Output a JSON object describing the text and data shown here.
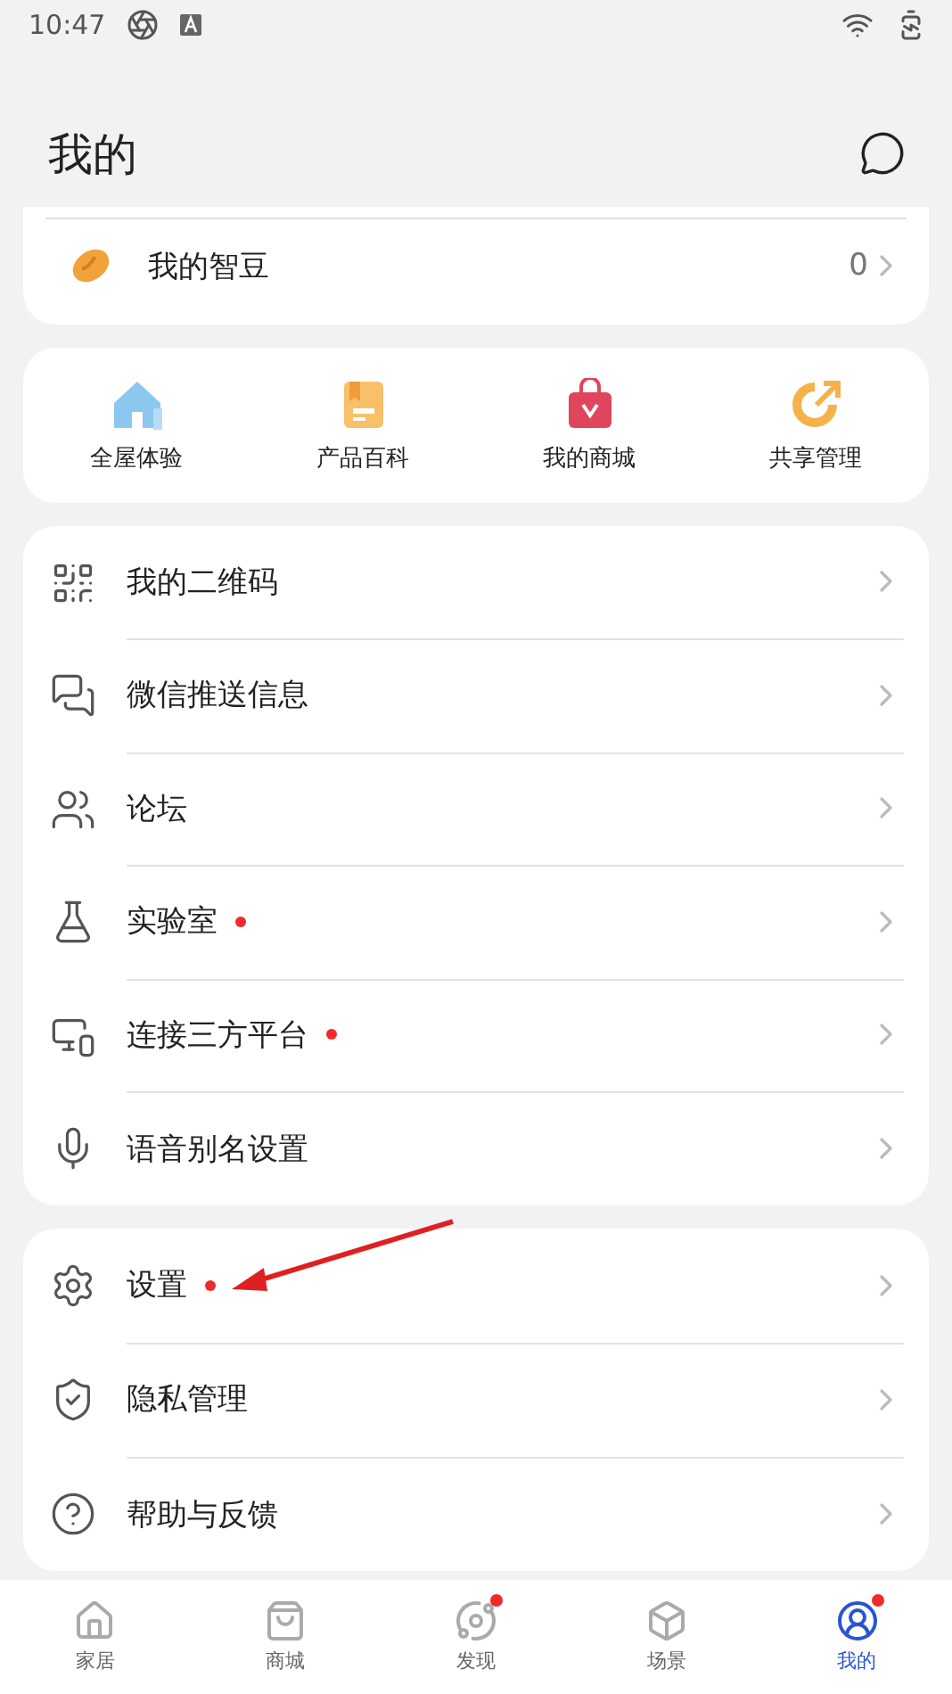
{
  "status_bar": {
    "time": "10:47"
  },
  "header": {
    "title": "我的"
  },
  "bean_row": {
    "label": "我的智豆",
    "value": "0"
  },
  "shortcuts": [
    {
      "label": "全屋体验",
      "kind": "house"
    },
    {
      "label": "产品百科",
      "kind": "book"
    },
    {
      "label": "我的商城",
      "kind": "bag"
    },
    {
      "label": "共享管理",
      "kind": "share"
    }
  ],
  "menu_groups": [
    [
      {
        "label": "我的二维码",
        "kind": "qr",
        "dot": false
      },
      {
        "label": "微信推送信息",
        "kind": "chat",
        "dot": false
      },
      {
        "label": "论坛",
        "kind": "users",
        "dot": false
      },
      {
        "label": "实验室",
        "kind": "flask",
        "dot": true
      },
      {
        "label": "连接三方平台",
        "kind": "link",
        "dot": true
      },
      {
        "label": "语音别名设置",
        "kind": "mic",
        "dot": false
      }
    ],
    [
      {
        "label": "设置",
        "kind": "gear",
        "dot": true
      },
      {
        "label": "隐私管理",
        "kind": "shield",
        "dot": false
      },
      {
        "label": "帮助与反馈",
        "kind": "help",
        "dot": false
      }
    ]
  ],
  "tab_bar": [
    {
      "label": "家居",
      "kind": "home",
      "selected": false,
      "dot": false
    },
    {
      "label": "商城",
      "kind": "store",
      "selected": false,
      "dot": false
    },
    {
      "label": "发现",
      "kind": "planet",
      "selected": false,
      "dot": true
    },
    {
      "label": "场景",
      "kind": "cube",
      "selected": false,
      "dot": false
    },
    {
      "label": "我的",
      "kind": "person",
      "selected": true,
      "dot": true
    }
  ]
}
